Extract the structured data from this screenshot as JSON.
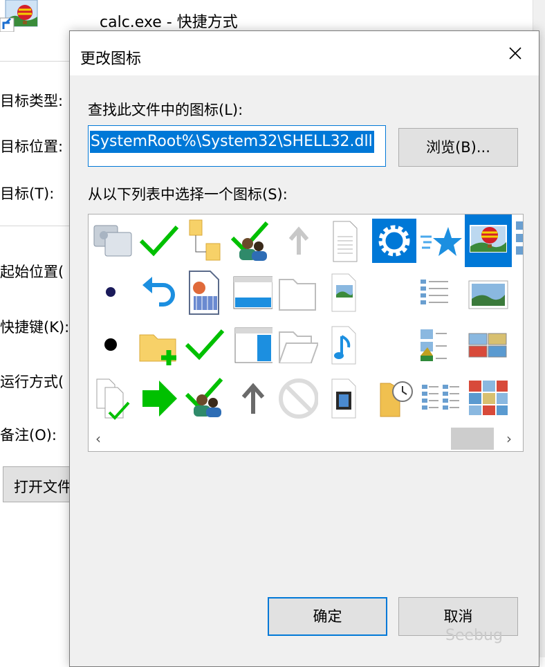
{
  "background_window": {
    "title": "calc.exe - 快捷方式",
    "labels": [
      "目标类型:",
      "目标位置:",
      "目标(T):",
      "起始位置(",
      "快捷键(K):",
      "运行方式(",
      "备注(O):"
    ],
    "open_location_button": "打开文件"
  },
  "dialog": {
    "title": "更改图标",
    "lookup_label": "查找此文件中的图标(L):",
    "path_value": "SystemRoot%\\System32\\SHELL32.dll",
    "browse_button": "浏览(B)...",
    "select_label": "从以下列表中选择一个图标(S):",
    "ok_button": "确定",
    "cancel_button": "取消",
    "scroll_left": "‹",
    "scroll_right": "›"
  },
  "icons": [
    "remote-desktop-icon",
    "check-icon",
    "folder-tree-icon",
    "users-check-icon",
    "up-arrow-icon",
    "document-icon",
    "gear-icon",
    "star-icon",
    "balloon-image-icon",
    "dot-icon",
    "undo-icon",
    "media-file-icon",
    "window-icon",
    "folder-outline-icon",
    "picture-file-icon",
    "details-list-icon",
    "landscape-icon",
    "dot-icon",
    "folder-add-icon",
    "check-icon",
    "window-split-icon",
    "folder-open-icon",
    "music-file-icon",
    "picture-list-icon",
    "photo-grid-icon",
    "copy-check-icon",
    "forward-arrow-icon",
    "users-check-icon",
    "up-arrow-icon",
    "disabled-icon",
    "video-file-icon",
    "folder-clock-icon",
    "picture-details-icon",
    "photo-grid-icon"
  ],
  "watermark": "Seebug",
  "colors": {
    "accent": "#0078d7",
    "dialog_bg": "#f0f0f0",
    "check_green": "#00c000"
  }
}
